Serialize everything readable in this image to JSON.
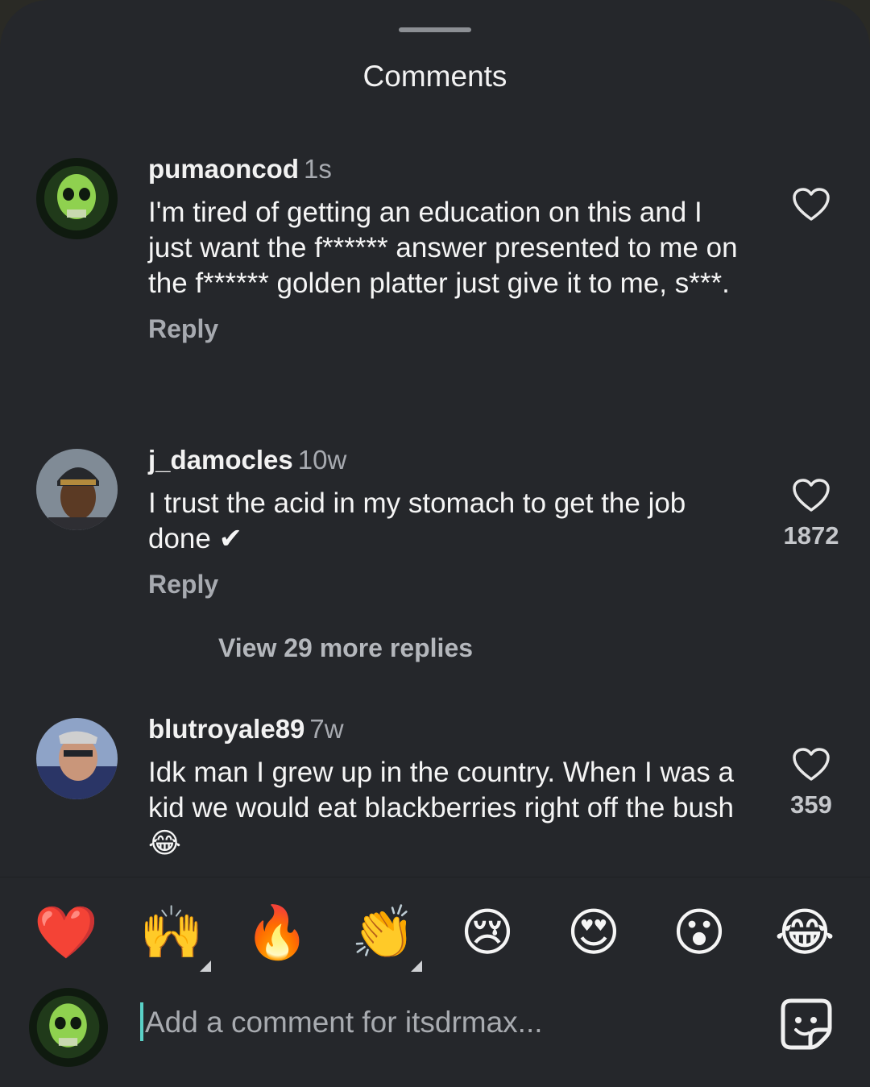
{
  "sheet": {
    "title": "Comments"
  },
  "comments": [
    {
      "username": "pumaoncod",
      "time": "1s",
      "text": "I'm tired of getting an education on this and I just want the f****** answer presented to me on the f****** golden platter just give it to me, s***.",
      "reply_label": "Reply",
      "likes": ""
    },
    {
      "username": "j_damocles",
      "time": "10w",
      "text": "I trust the acid in my stomach to get the job done ✔",
      "reply_label": "Reply",
      "likes": "1872",
      "view_more": "View 29 more replies"
    },
    {
      "username": "blutroyale89",
      "time": "7w",
      "text": "Idk man I grew up in the country. When I was a kid we would eat blackberries right off the bush 😂",
      "likes": "359"
    }
  ],
  "emoji_bar": [
    "❤️",
    "🙌",
    "🔥",
    "👏",
    "😢",
    "😍",
    "😮",
    "😂"
  ],
  "composer": {
    "placeholder": "Add a comment for itsdrmax..."
  },
  "icons": {
    "like": "heart-outline-icon",
    "sticker": "sticker-smile-icon"
  }
}
